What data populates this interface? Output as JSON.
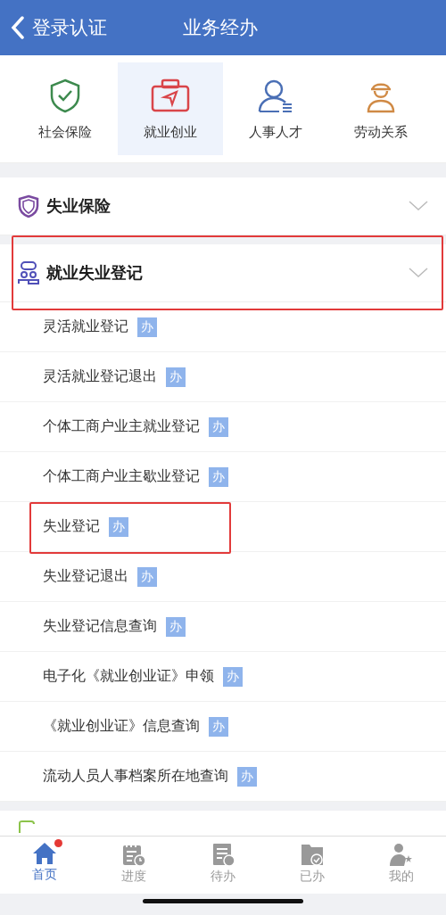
{
  "header": {
    "back_label": "登录认证",
    "title": "业务经办"
  },
  "categories": [
    {
      "label": "社会保险",
      "selected": false,
      "kind": "shield"
    },
    {
      "label": "就业创业",
      "selected": true,
      "kind": "briefcase"
    },
    {
      "label": "人事人才",
      "selected": false,
      "kind": "person"
    },
    {
      "label": "劳动关系",
      "selected": false,
      "kind": "worker"
    }
  ],
  "sections": [
    {
      "title": "失业保险",
      "kind": "shield",
      "expanded": false,
      "highlighted": false
    },
    {
      "title": "就业失业登记",
      "kind": "people",
      "expanded": true,
      "highlighted": true,
      "items": [
        {
          "label": "灵活就业登记",
          "badge": "办",
          "highlighted": false
        },
        {
          "label": "灵活就业登记退出",
          "badge": "办",
          "highlighted": false
        },
        {
          "label": "个体工商户业主就业登记",
          "badge": "办",
          "highlighted": false
        },
        {
          "label": "个体工商户业主歇业登记",
          "badge": "办",
          "highlighted": false
        },
        {
          "label": "失业登记",
          "badge": "办",
          "highlighted": true
        },
        {
          "label": "失业登记退出",
          "badge": "办",
          "highlighted": false
        },
        {
          "label": "失业登记信息查询",
          "badge": "办",
          "highlighted": false
        },
        {
          "label": "电子化《就业创业证》申领",
          "badge": "办",
          "highlighted": false
        },
        {
          "label": "《就业创业证》信息查询",
          "badge": "办",
          "highlighted": false
        },
        {
          "label": "流动人员人事档案所在地查询",
          "badge": "办",
          "highlighted": false
        }
      ]
    }
  ],
  "tab_bar": [
    {
      "label": "首页",
      "selected": true,
      "kind": "home",
      "notification": true
    },
    {
      "label": "进度",
      "selected": false,
      "kind": "calendar",
      "notification": false
    },
    {
      "label": "待办",
      "selected": false,
      "kind": "doc",
      "notification": false
    },
    {
      "label": "已办",
      "selected": false,
      "kind": "folder",
      "notification": false
    },
    {
      "label": "我的",
      "selected": false,
      "kind": "user",
      "notification": false
    }
  ]
}
